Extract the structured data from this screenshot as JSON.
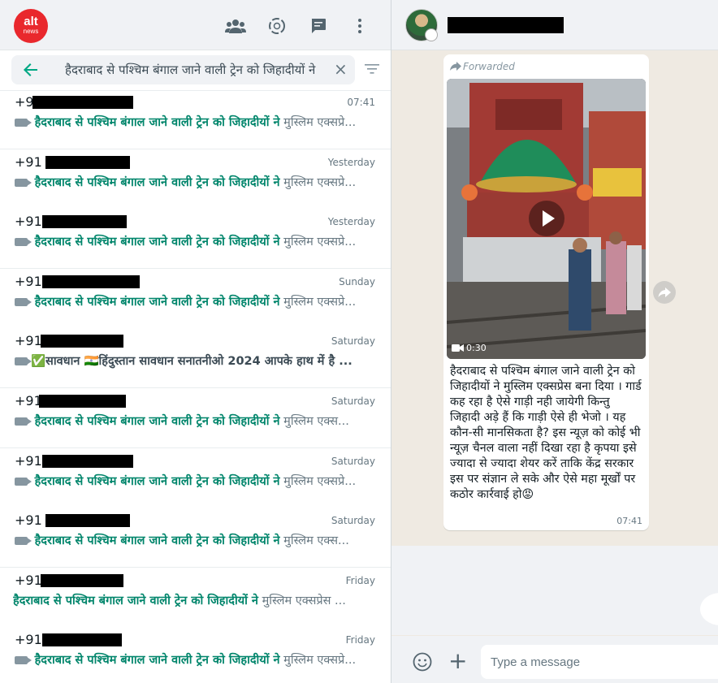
{
  "left_header": {
    "logo_line1": "alt",
    "logo_line2": "news",
    "icons": [
      "community-icon",
      "status-icon",
      "new-chat-icon",
      "menu-icon"
    ]
  },
  "search": {
    "query": "हैदराबाद से पश्चिम बंगाल जाने वाली ट्रेन को जिहादीयों ने",
    "clear_label": "×"
  },
  "chats": [
    {
      "name": "+91",
      "time": "07:41",
      "highlight": "हैदराबाद से पश्चिम बंगाल जाने वाली ट्रेन को जिहादीयों ने",
      "rest": " मुस्लिम एक्सप्रे..."
    },
    {
      "name": "+91 9",
      "time": "Yesterday",
      "highlight": "हैदराबाद से पश्चिम बंगाल जाने वाली ट्रेन को जिहादीयों ने",
      "rest": " मुस्लिम एक्सप्रे..."
    },
    {
      "name": "+91",
      "time": "Yesterday",
      "highlight": "हैदराबाद से पश्चिम बंगाल जाने वाली ट्रेन को जिहादीयों ने",
      "rest": " मुस्लिम एक्सप्रे..."
    },
    {
      "name": "+91",
      "time": "Sunday",
      "highlight": "हैदराबाद से पश्चिम बंगाल जाने वाली ट्रेन को जिहादीयों ने",
      "rest": " मुस्लिम एक्सप्रे..."
    },
    {
      "name": "+91",
      "time": "Saturday",
      "highlight": "",
      "rest": "✅सावधान 🇮🇳हिंदुस्तान सावधान सनातनीओ 2024 आपके हाथ में है ..."
    },
    {
      "name": "+91",
      "time": "Saturday",
      "highlight": "हैदराबाद से पश्चिम बंगाल जाने वाली ट्रेन को जिहादीयों ने",
      "rest": " मुस्लिम एक्स..."
    },
    {
      "name": "+91",
      "time": "Saturday",
      "highlight": "हैदराबाद से पश्चिम बंगाल जाने वाली ट्रेन को जिहादीयों ने",
      "rest": " मुस्लिम एक्सप्रे..."
    },
    {
      "name": "+91 8",
      "time": "Saturday",
      "highlight": "हैदराबाद से पश्चिम बंगाल जाने वाली ट्रेन को जिहादीयों ने",
      "rest": " मुस्लिम एक्स..."
    },
    {
      "name": "+91",
      "time": "Friday",
      "highlight": "हैदराबाद से पश्चिम बंगाल जाने वाली ट्रेन को जिहादीयों ने",
      "rest": " मुस्लिम एक्सप्रेस ..."
    },
    {
      "name": "+91",
      "time": "Friday",
      "highlight": "हैदराबाद से पश्चिम बंगाल जाने वाली ट्रेन को जिहादीयों ने",
      "rest": " मुस्लिम एक्सप्रे..."
    }
  ],
  "message": {
    "forwarded_label": "Forwarded",
    "video_duration": "0:30",
    "caption": "हैदराबाद से पश्चिम बंगाल जाने वाली ट्रेन को जिहादीयों ने मुस्लिम एक्सप्रेस बना दिया । गार्ड कह रहा है ऐसे गाड़ी नही जायेगी किन्तु जिहादी अड़े हैं कि गाड़ी ऐसे ही भेजो । यह कौन-सी मानसिकता है? इस न्यूज़ को कोई भी न्यूज़ चैनल वाला नहीं दिखा रहा है कृपया इसे ज्यादा से ज्यादा शेयर करें ताकि केंद्र सरकार इस पर संज्ञान ले सके और ऐसे महा मूर्खों पर कठोर कार्रवाई हो😡",
    "time": "07:41"
  },
  "composer": {
    "placeholder": "Type a message",
    "attach_label": "+"
  },
  "colors": {
    "accent": "#00856b",
    "header_bg": "#f0f2f5",
    "chat_bg": "#efeae2"
  }
}
